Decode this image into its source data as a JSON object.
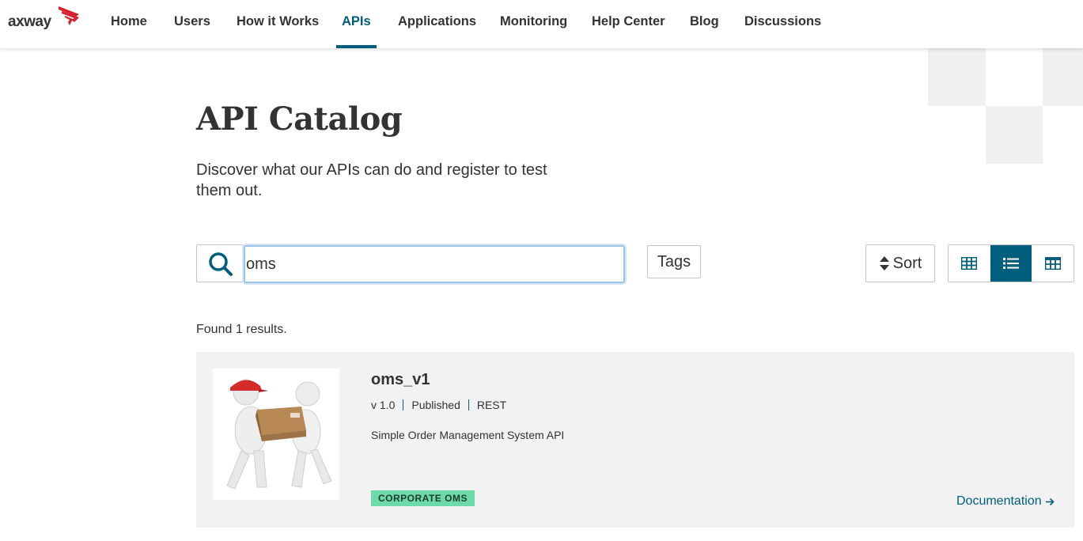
{
  "header": {
    "logo_text": "axway",
    "nav": [
      {
        "label": "Home"
      },
      {
        "label": "Users"
      },
      {
        "label": "How it Works"
      },
      {
        "label": "APIs"
      },
      {
        "label": "Applications"
      },
      {
        "label": "Monitoring"
      },
      {
        "label": "Help Center"
      },
      {
        "label": "Blog"
      },
      {
        "label": "Discussions"
      }
    ],
    "active_nav": "APIs"
  },
  "hero": {
    "title": "API Catalog",
    "subtitle": "Discover what our APIs can do and register to test them out."
  },
  "toolbar": {
    "search_value": "oms",
    "tags_label": "Tags",
    "sort_label": "Sort",
    "view_modes": [
      "grid-icon",
      "list-icon",
      "table-icon"
    ],
    "active_view": "list-icon"
  },
  "results": {
    "count_text": "Found 1 results."
  },
  "api_card": {
    "name": "oms_v1",
    "version": "v 1.0",
    "status": "Published",
    "type": "REST",
    "description": "Simple Order Management System API",
    "tag": "CORPORATE OMS",
    "doc_link": "Documentation"
  },
  "colors": {
    "brand_red": "#d5202f",
    "accent_teal": "#005e7d",
    "tag_green": "#6ed9a9",
    "card_bg": "#f2f2f2"
  }
}
